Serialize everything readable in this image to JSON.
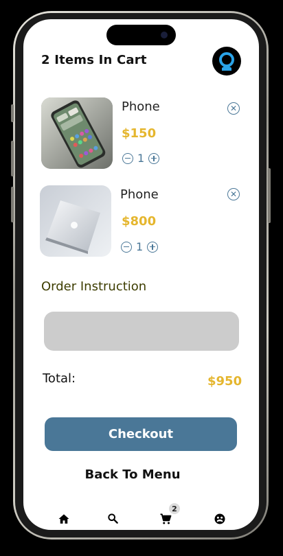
{
  "header": {
    "title": "2 Items In Cart",
    "avatar_icon": "user-avatar-icon"
  },
  "cart": {
    "items": [
      {
        "name": "Phone",
        "price": "$150",
        "quantity": "1",
        "image": "smartphone-photo"
      },
      {
        "name": "Phone",
        "price": "$800",
        "quantity": "1",
        "image": "laptop-photo"
      }
    ]
  },
  "instructions": {
    "label": "Order Instruction",
    "placeholder": ""
  },
  "total": {
    "label": "Total:",
    "value": "$950"
  },
  "actions": {
    "checkout_label": "Checkout",
    "back_label": "Back To Menu"
  },
  "bottom_nav": {
    "items": [
      {
        "icon": "home-icon"
      },
      {
        "icon": "search-icon"
      },
      {
        "icon": "cart-icon",
        "badge": "2"
      },
      {
        "icon": "profile-icon"
      }
    ]
  },
  "colors": {
    "accent": "#4a7797",
    "price": "#e5b62e",
    "input_bg": "#cccccc"
  }
}
